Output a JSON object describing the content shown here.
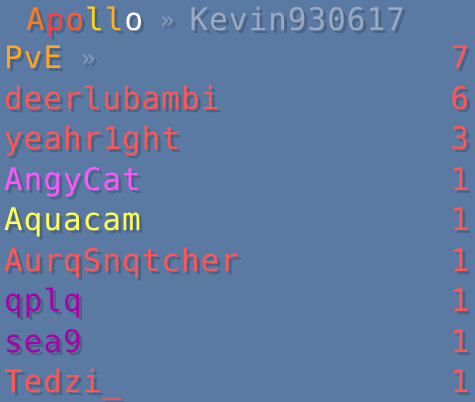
{
  "header": {
    "server_letters": [
      {
        "ch": "A",
        "color": "#ff7a1a"
      },
      {
        "ch": "p",
        "color": "#ff3a3a"
      },
      {
        "ch": "o",
        "color": "#ff5a2a"
      },
      {
        "ch": "l",
        "color": "#ffd21a"
      },
      {
        "ch": "l",
        "color": "#ffb01a"
      },
      {
        "ch": "o",
        "color": "#ffffff"
      }
    ],
    "separator": "»",
    "separator_color": "#8a99b8",
    "player_name": "Kevin930617",
    "player_color": "#9aa8c2"
  },
  "scoreboard": {
    "rows": [
      {
        "name": "PvE",
        "name_color": "#ffa51f",
        "suffix": "»",
        "suffix_color": "#8a99b8",
        "score": "7",
        "score_color": "#ff5555"
      },
      {
        "name": "deerlubambi",
        "name_color": "#ff5555",
        "suffix": "",
        "score": "6",
        "score_color": "#ff5555"
      },
      {
        "name": "yeahr1ght",
        "name_color": "#ff5555",
        "suffix": "",
        "score": "3",
        "score_color": "#ff5555"
      },
      {
        "name": "AngyCat",
        "name_color": "#ff55ff",
        "suffix": "",
        "score": "1",
        "score_color": "#ff5555"
      },
      {
        "name": "Aquacam",
        "name_color": "#ffff55",
        "suffix": "",
        "score": "1",
        "score_color": "#ff5555"
      },
      {
        "name": "AurqSnqtcher",
        "name_color": "#ff5555",
        "suffix": "",
        "score": "1",
        "score_color": "#ff5555"
      },
      {
        "name": "qplq",
        "name_color": "#aa00aa",
        "suffix": "",
        "score": "1",
        "score_color": "#ff5555"
      },
      {
        "name": "sea9",
        "name_color": "#aa00aa",
        "suffix": "",
        "score": "1",
        "score_color": "#ff5555"
      },
      {
        "name": "Tedzi_",
        "name_color": "#ff5555",
        "suffix": "",
        "score": "1",
        "score_color": "#ff5555"
      }
    ]
  }
}
